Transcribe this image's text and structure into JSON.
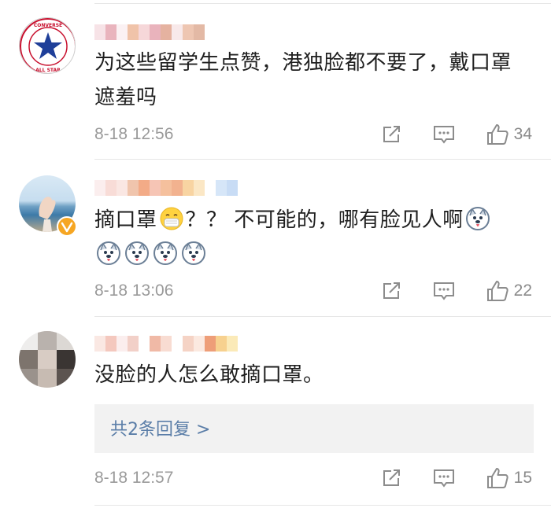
{
  "comments": [
    {
      "text": "为这些留学生点赞，港独脸都不要了，戴口罩遮羞吗",
      "time": "8-18 12:56",
      "likes": "34",
      "avatar_text": "CONVERSE ALL STAR"
    },
    {
      "text": "摘口罩",
      "text_after": "？？ 不可能的，哪有脸见人啊",
      "emoji_line": [
        "doge-icon",
        "doge-icon",
        "doge-icon",
        "doge-icon"
      ],
      "time": "8-18 13:06",
      "likes": "22"
    },
    {
      "text": "没脸的人怎么敢摘口罩。",
      "replies_label": "共2条回复 >",
      "time": "8-18 12:57",
      "likes": "15"
    }
  ],
  "colors": {
    "link": "#5b7ea8",
    "time": "#9a9a9a",
    "reply_bg": "#f2f2f2"
  }
}
